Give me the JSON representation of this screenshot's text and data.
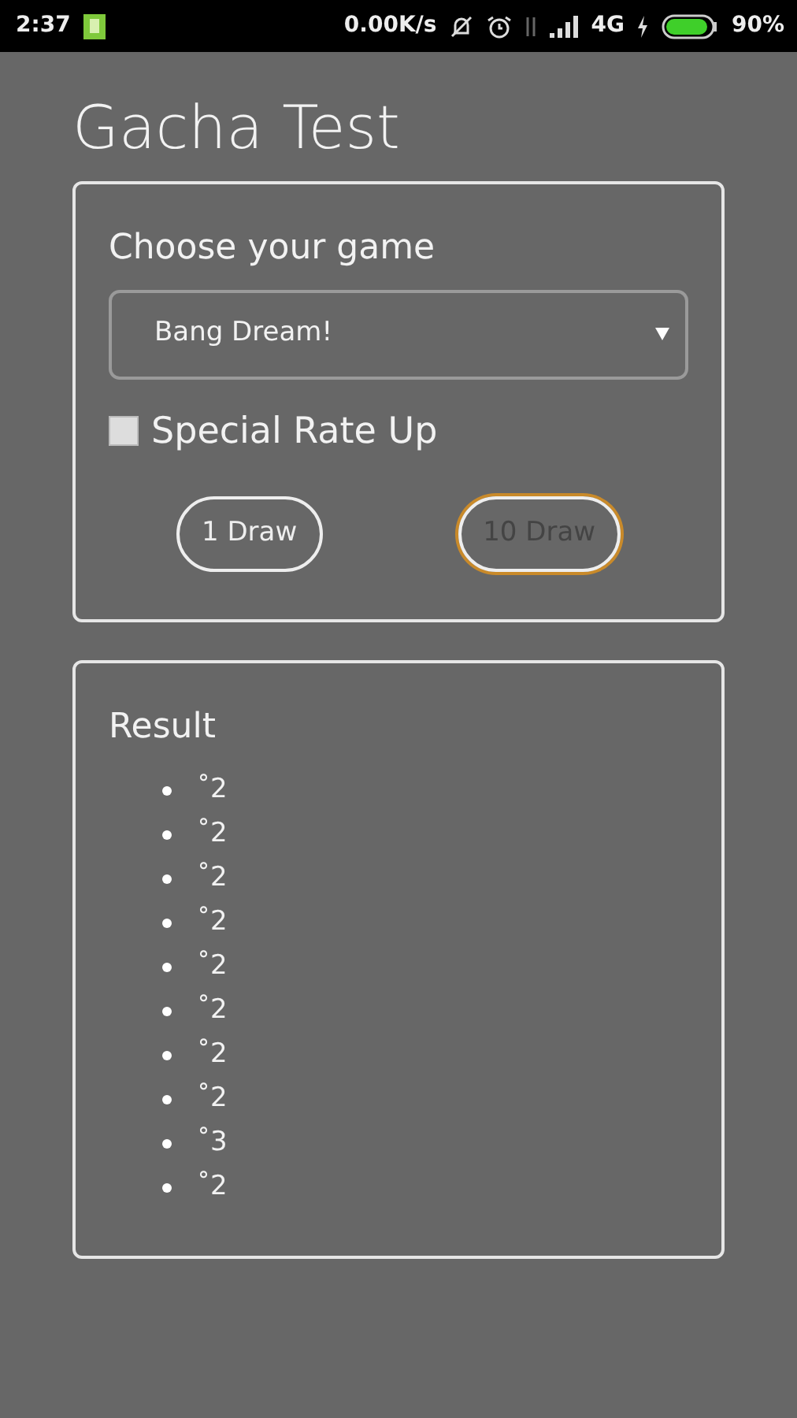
{
  "status_bar": {
    "time": "2:37",
    "speed": "0.00K/s",
    "network": "4G",
    "battery": "90%"
  },
  "title": "Gacha Test",
  "game_card": {
    "label": "Choose your game",
    "select_value": "Bang Dream!",
    "rate_up": {
      "label": "Special Rate Up",
      "checked": false
    },
    "buttons": [
      {
        "label": "1 Draw",
        "focused": false
      },
      {
        "label": "10 Draw",
        "focused": true
      }
    ]
  },
  "result_card": {
    "heading": "Result",
    "items": [
      "˚2",
      "˚2",
      "˚2",
      "˚2",
      "˚2",
      "˚2",
      "˚2",
      "˚2",
      "˚3",
      "˚2"
    ]
  }
}
